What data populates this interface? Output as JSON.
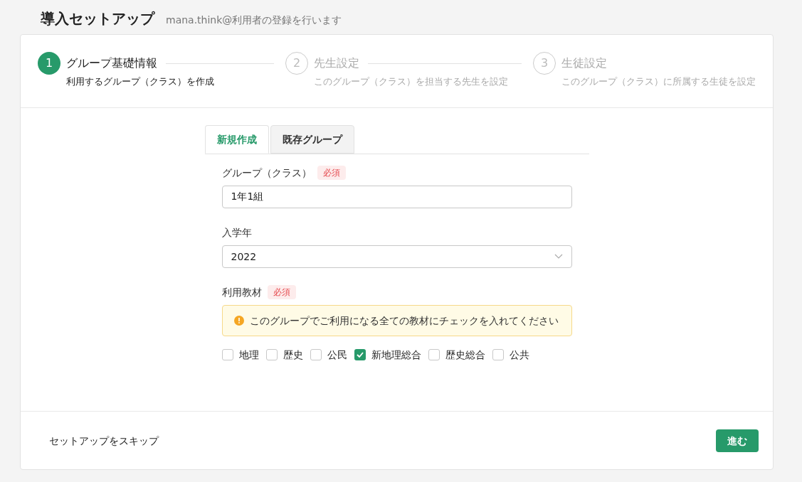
{
  "header": {
    "title": "導入セットアップ",
    "subtitle": "mana.think@利用者の登録を行います"
  },
  "steps": [
    {
      "number": "1",
      "title": "グループ基礎情報",
      "description": "利用するグループ（クラス）を作成",
      "selected": true
    },
    {
      "number": "2",
      "title": "先生設定",
      "description": "このグループ（クラス）を担当する先生を設定",
      "selected": false
    },
    {
      "number": "3",
      "title": "生徒設定",
      "description": "このグループ（クラス）に所属する生徒を設定",
      "selected": false
    }
  ],
  "tabs": [
    {
      "label": "新規作成",
      "selected": true
    },
    {
      "label": "既存グループ",
      "selected": false
    }
  ],
  "fields": [
    {
      "kind": "text",
      "label": "グループ（クラス）",
      "required_badge": "必須",
      "value": "1年1組"
    },
    {
      "kind": "select",
      "label": "入学年",
      "value": "2022"
    },
    {
      "kind": "checkboxes",
      "label": "利用教材",
      "required_badge": "必須",
      "notice": "このグループでご利用になる全ての教材にチェックを入れてください",
      "options": [
        {
          "label": "地理",
          "checked": false
        },
        {
          "label": "歴史",
          "checked": false
        },
        {
          "label": "公民",
          "checked": false
        },
        {
          "label": "新地理総合",
          "checked": true
        },
        {
          "label": "歴史総合",
          "checked": false
        },
        {
          "label": "公共",
          "checked": false
        }
      ]
    }
  ],
  "footer": {
    "skip_link": "セットアップをスキップ",
    "next_button": "進む"
  }
}
